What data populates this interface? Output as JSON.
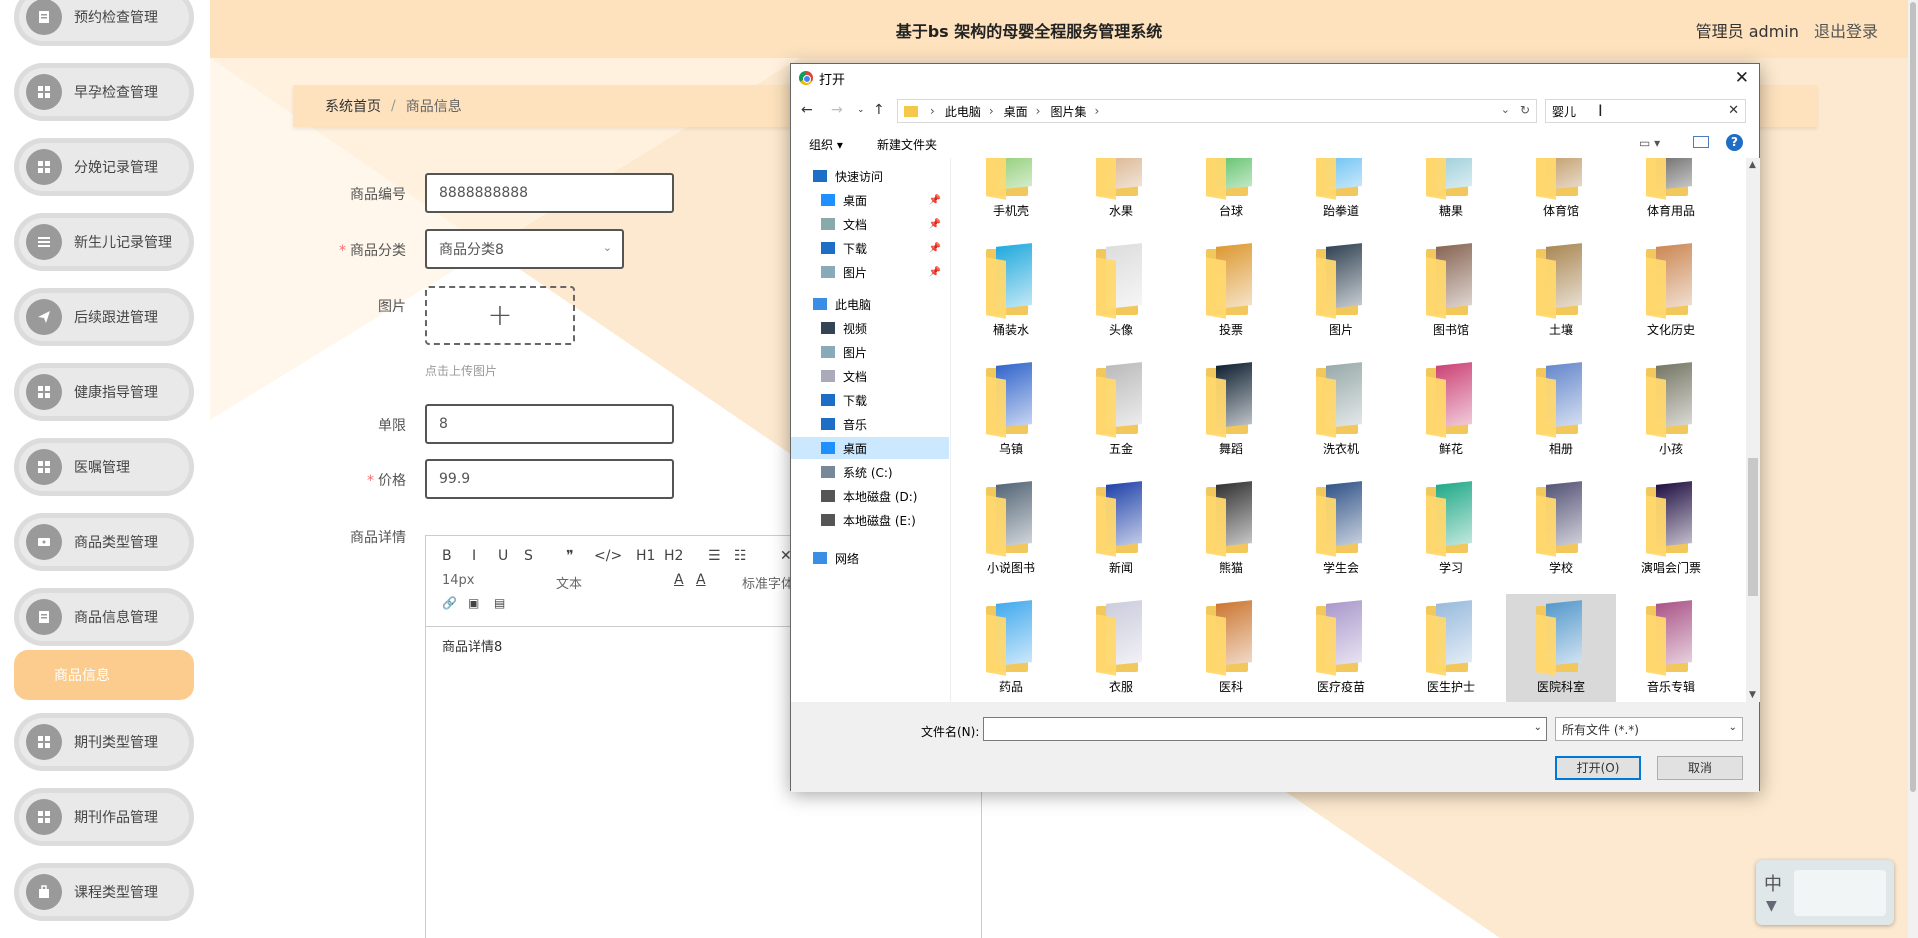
{
  "header": {
    "title": "基于bs 架构的母婴全程服务管理系统",
    "user": "管理员 admin",
    "logout": "退出登录"
  },
  "sidebar": {
    "items": [
      {
        "label": "预约检查管理",
        "icon": "clipboard-icon"
      },
      {
        "label": "早孕检查管理",
        "icon": "grid-icon"
      },
      {
        "label": "分娩记录管理",
        "icon": "grid-icon"
      },
      {
        "label": "新生儿记录管理",
        "icon": "list-icon"
      },
      {
        "label": "后续跟进管理",
        "icon": "send-icon"
      },
      {
        "label": "健康指导管理",
        "icon": "grid-icon"
      },
      {
        "label": "医嘱管理",
        "icon": "grid-icon"
      },
      {
        "label": "商品类型管理",
        "icon": "ticket-icon"
      },
      {
        "label": "商品信息管理",
        "icon": "clipboard-icon"
      },
      {
        "label": "期刊类型管理",
        "icon": "grid-icon"
      },
      {
        "label": "期刊作品管理",
        "icon": "grid-icon"
      },
      {
        "label": "课程类型管理",
        "icon": "bag-icon"
      }
    ],
    "active_sub": "商品信息"
  },
  "breadcrumb": {
    "home": "系统首页",
    "sep": "/",
    "current": "商品信息"
  },
  "form": {
    "code_label": "商品编号",
    "code_value": "8888888888",
    "category_label": "商品分类",
    "category_value": "商品分类8",
    "image_label": "图片",
    "upload_plus": "+",
    "upload_hint": "点击上传图片",
    "limit_label": "单限",
    "limit_value": "8",
    "price_label": "价格",
    "price_value": "99.9",
    "detail_label": "商品详情",
    "required_mark": "*"
  },
  "editor": {
    "toolbar_row1": [
      "B",
      "I",
      "U",
      "S",
      "❞",
      "</>",
      "H1",
      "H2",
      "☰",
      "☷"
    ],
    "font_size": "14px",
    "format": "文本",
    "font_family": "标准字体",
    "close": "✕",
    "content": "商品详情8"
  },
  "dialog": {
    "title": "打开",
    "close": "✕",
    "path": [
      "此电脑",
      "桌面",
      "图片集"
    ],
    "search_value": "婴儿",
    "organize": "组织 ▾",
    "new_folder": "新建文件夹",
    "nav": {
      "quick_access": "快速访问",
      "quick": [
        "桌面",
        "文档",
        "下载",
        "图片"
      ],
      "this_pc": "此电脑",
      "pc": [
        "视频",
        "图片",
        "文档",
        "下载",
        "音乐",
        "桌面",
        "系统 (C:)",
        "本地磁盘 (D:)",
        "本地磁盘 (E:)"
      ],
      "network": "网络"
    },
    "folders": [
      "手机壳",
      "水果",
      "台球",
      "跆拳道",
      "糖果",
      "体育馆",
      "体育用品",
      "桶装水",
      "头像",
      "投票",
      "图片",
      "图书馆",
      "土壤",
      "文化历史",
      "乌镇",
      "五金",
      "舞蹈",
      "洗衣机",
      "鲜花",
      "相册",
      "小孩",
      "小说图书",
      "新闻",
      "熊猫",
      "学生会",
      "学习",
      "学校",
      "演唱会门票",
      "药品",
      "衣服",
      "医科",
      "医疗疫苗",
      "医生护士",
      "医院科室",
      "音乐专辑"
    ],
    "selected_folder": "医院科室",
    "filename_label": "文件名(N):",
    "filename_value": "",
    "filetype": "所有文件 (*.*)",
    "open_btn": "打开(O)",
    "cancel_btn": "取消"
  },
  "ime": {
    "mode": "中"
  },
  "colors": {
    "accent": "#fccb8e",
    "header_bg": "#fde2bd",
    "sidebar_pill": "#e9e9e9"
  }
}
